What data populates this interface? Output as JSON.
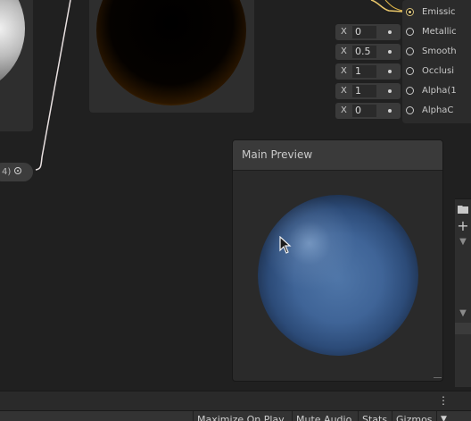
{
  "graph": {
    "master_node_ports": [
      {
        "label": "Emissic",
        "active": true
      },
      {
        "label": "Metallic",
        "active": false
      },
      {
        "label": "Smooth",
        "active": false
      },
      {
        "label": "Occlusi",
        "active": false
      },
      {
        "label": "Alpha(1",
        "active": false
      },
      {
        "label": "AlphaC",
        "active": false
      }
    ],
    "input_fields": [
      {
        "axis": "X",
        "value": "0"
      },
      {
        "axis": "X",
        "value": "0.5"
      },
      {
        "axis": "X",
        "value": "1"
      },
      {
        "axis": "X",
        "value": "1"
      },
      {
        "axis": "X",
        "value": "0"
      }
    ],
    "output_pill_label": "4)"
  },
  "main_preview": {
    "title": "Main Preview"
  },
  "side_panel": {
    "icons": [
      "folder-icon",
      "plus-icon",
      "triangle-down-icon",
      "triangle-down-icon"
    ]
  },
  "toolbar": {
    "buttons": [
      "Maximize On Play",
      "Mute Audio",
      "Stats",
      "Gizmos"
    ],
    "kebab": "⋮",
    "gizmos_dropdown": "▼"
  },
  "colors": {
    "rim_glow": "#ffcc1a",
    "sphere_blue": "#3f6497",
    "active_port": "#d9c27a"
  }
}
